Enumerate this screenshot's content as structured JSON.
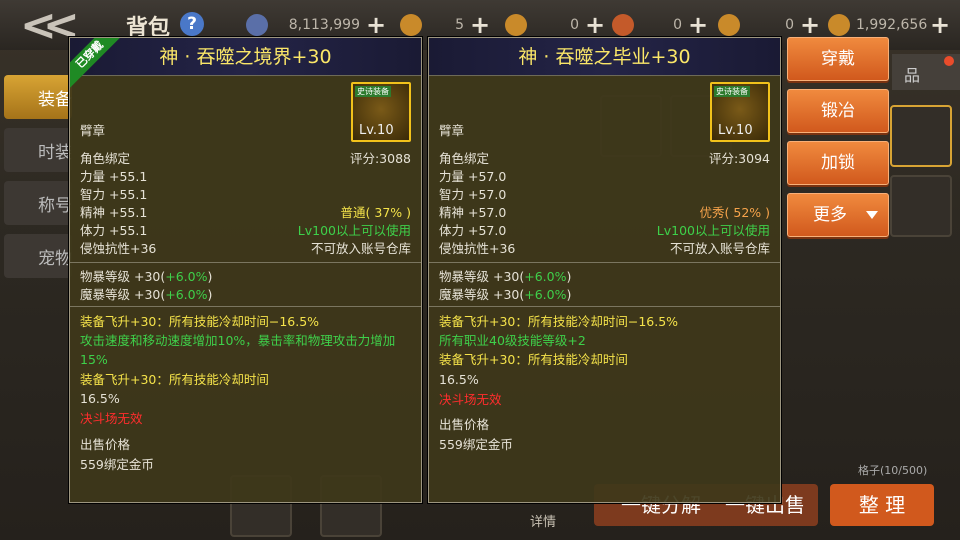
{
  "header": {
    "title": "背包",
    "currencies": [
      {
        "icon": "diamond-icon",
        "value": "8,113,999",
        "color": "#5a6fa8"
      },
      {
        "icon": "gold-token-icon",
        "value": "5",
        "color": "#c98a2a"
      },
      {
        "icon": "scroll-icon",
        "value": "0",
        "color": "#c98a2a"
      },
      {
        "icon": "scroll-red-icon",
        "value": "0",
        "color": "#c45a2a"
      },
      {
        "icon": "coin-icon",
        "value": "0",
        "color": "#c98a2a"
      },
      {
        "icon": "gold-bag-icon",
        "value": "1,992,656",
        "color": "#c98a2a"
      }
    ]
  },
  "left_tabs": [
    "装备",
    "时装",
    "称号",
    "宠物"
  ],
  "right_tab": "品",
  "bottom": {
    "capacity": "格子(10/500)",
    "detail": "详情",
    "buttons": [
      "一键分解",
      "一键出售",
      "整 理"
    ]
  },
  "panels": [
    {
      "equipped_label": "已穿戴",
      "title": "神 · 吞噬之境界+30",
      "icon_tag": "史诗装备",
      "icon_level": "Lv.10",
      "slot": "臂章",
      "binding": "角色绑定",
      "score": "评分:3088",
      "stats": [
        "力量 +55.1",
        "智力 +55.1",
        "精神 +55.1",
        "体力 +55.1",
        "侵蚀抗性+36"
      ],
      "quality": "普通( 37% )",
      "level_req": "Lv100以上可以使用",
      "storage": "不可放入账号仓库",
      "extra_stats": [
        {
          "label": "物暴等级 +30(",
          "bonus": "+6.0%",
          "close": ")"
        },
        {
          "label": "魔暴等级 +30(",
          "bonus": "+6.0%",
          "close": ")"
        }
      ],
      "effects": [
        {
          "text": "装备飞升+30：所有技能冷却时间−16.5%",
          "color": "yellow"
        },
        {
          "text": "攻击速度和移动速度增加10%，暴击率和物理攻击力增加15%",
          "color": "green"
        },
        {
          "text": "装备飞升+30：所有技能冷却时间",
          "color": "yellow"
        },
        {
          "text": "16.5%",
          "color": "white"
        },
        {
          "text": "决斗场无效",
          "color": "red"
        }
      ],
      "sell_label": "出售价格",
      "sell_value": "559绑定金币"
    },
    {
      "equipped_label": "",
      "title": "神 · 吞噬之毕业+30",
      "icon_tag": "史诗装备",
      "icon_level": "Lv.10",
      "slot": "臂章",
      "binding": "角色绑定",
      "score": "评分:3094",
      "stats": [
        "力量 +57.0",
        "智力 +57.0",
        "精神 +57.0",
        "体力 +57.0",
        "侵蚀抗性+36"
      ],
      "quality": "优秀( 52% )",
      "level_req": "Lv100以上可以使用",
      "storage": "不可放入账号仓库",
      "extra_stats": [
        {
          "label": "物暴等级 +30(",
          "bonus": "+6.0%",
          "close": ")"
        },
        {
          "label": "魔暴等级 +30(",
          "bonus": "+6.0%",
          "close": ")"
        }
      ],
      "effects": [
        {
          "text": "装备飞升+30：所有技能冷却时间−16.5%",
          "color": "yellow"
        },
        {
          "text": "所有职业40级技能等级+2",
          "color": "green"
        },
        {
          "text": "装备飞升+30：所有技能冷却时间",
          "color": "yellow"
        },
        {
          "text": "16.5%",
          "color": "white"
        },
        {
          "text": "决斗场无效",
          "color": "red"
        }
      ],
      "sell_label": "出售价格",
      "sell_value": "559绑定金币"
    }
  ],
  "actions": [
    "穿戴",
    "锻冶",
    "加锁",
    "更多"
  ]
}
